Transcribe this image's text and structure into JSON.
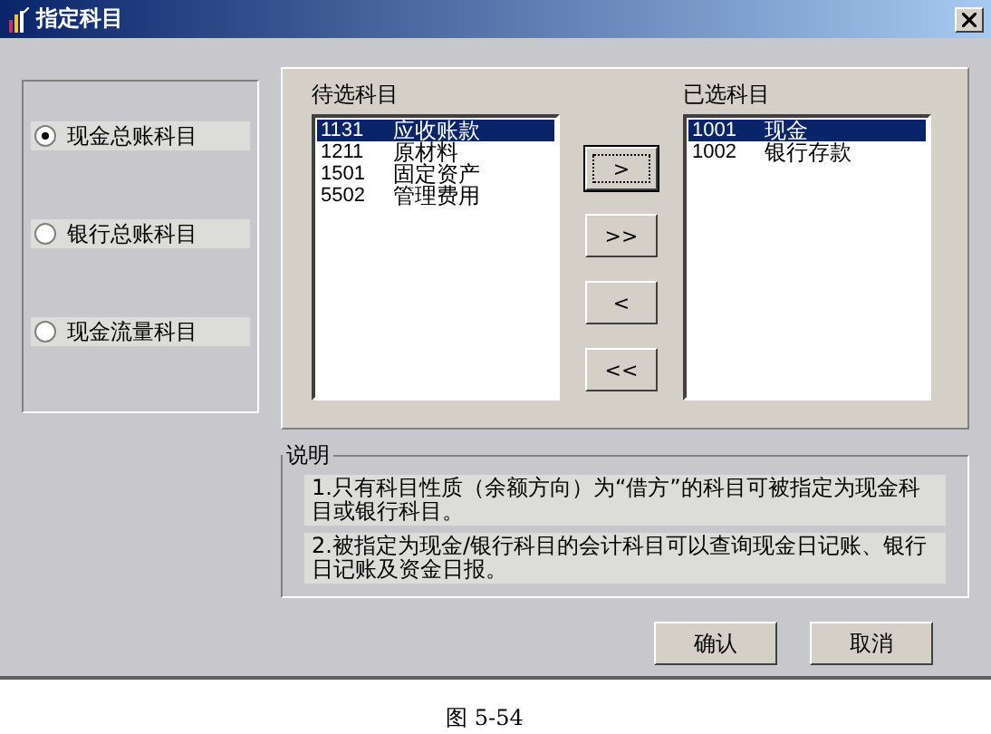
{
  "window": {
    "title": "指定科目"
  },
  "radios": [
    {
      "label": "现金总账科目",
      "selected": true
    },
    {
      "label": "银行总账科目",
      "selected": false
    },
    {
      "label": "现金流量科目",
      "selected": false
    }
  ],
  "available": {
    "title": "待选科目",
    "items": [
      {
        "code": "1131",
        "name": "应收账款",
        "selected": true
      },
      {
        "code": "1211",
        "name": "原材料",
        "selected": false
      },
      {
        "code": "1501",
        "name": "固定资产",
        "selected": false
      },
      {
        "code": "5502",
        "name": "管理费用",
        "selected": false
      }
    ]
  },
  "move_buttons": [
    {
      "label": ">",
      "focused": true
    },
    {
      "label": ">>",
      "focused": false
    },
    {
      "label": "<",
      "focused": false
    },
    {
      "label": "<<",
      "focused": false
    }
  ],
  "chosen": {
    "title": "已选科目",
    "items": [
      {
        "code": "1001",
        "name": "现金",
        "selected": true
      },
      {
        "code": "1002",
        "name": "银行存款",
        "selected": false
      }
    ]
  },
  "note": {
    "title": "说明",
    "lines": [
      "1.只有科目性质（余额方向）为“借方”的科目可被指定为现金科目或银行科目。",
      "2.被指定为现金/银行科目的会计科目可以查询现金日记账、银行日记账及资金日报。"
    ]
  },
  "buttons": [
    "确认",
    "取消"
  ],
  "caption": "图 5-54"
}
